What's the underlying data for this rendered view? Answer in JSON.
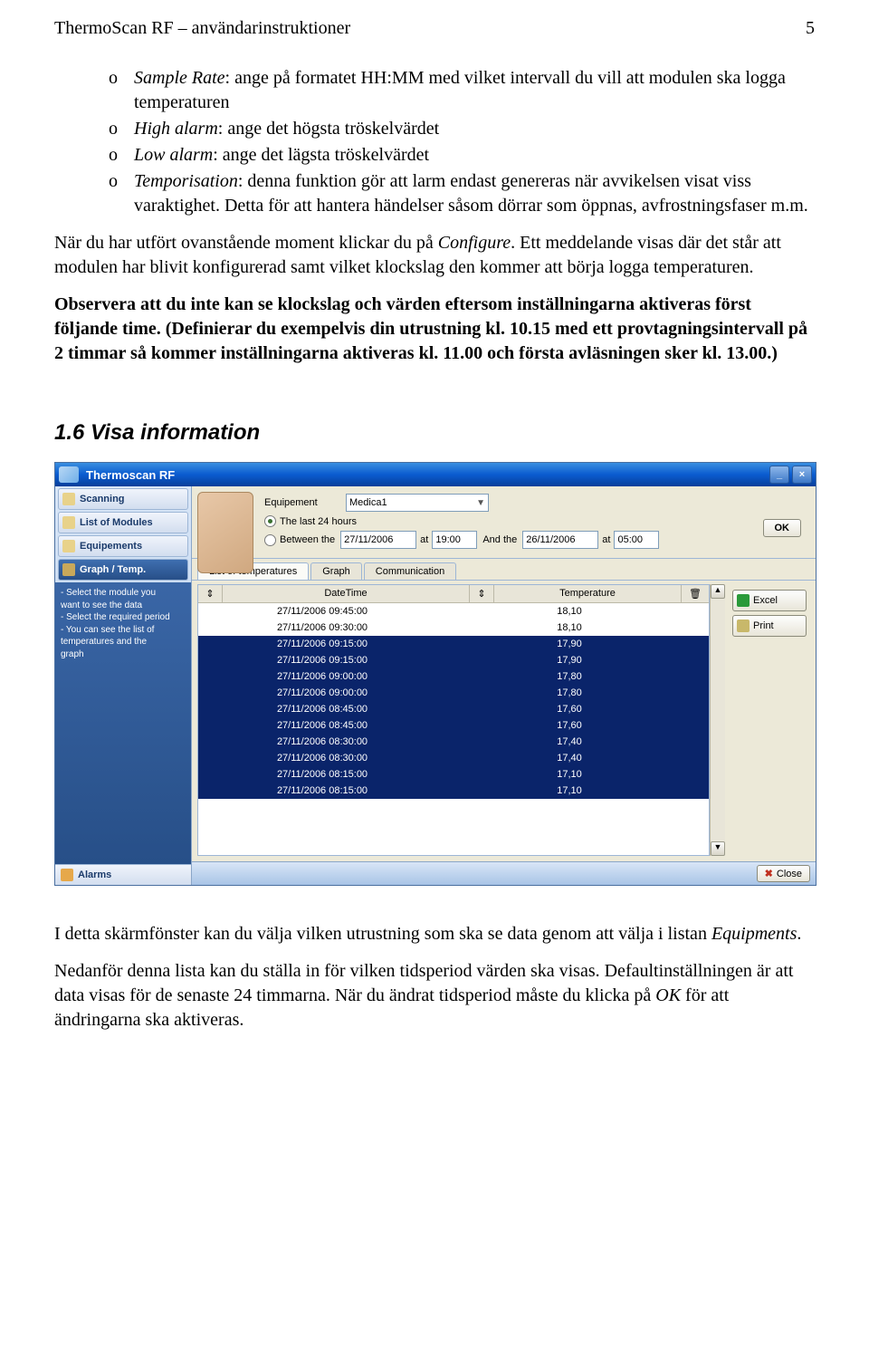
{
  "header": {
    "title": "ThermoScan RF – användarinstruktioner",
    "page": "5"
  },
  "bullets": [
    {
      "term": "Sample Rate",
      "text": ": ange på formatet HH:MM med vilket intervall du vill att modulen ska logga temperaturen"
    },
    {
      "term": "High alarm",
      "text": ": ange det högsta tröskelvärdet"
    },
    {
      "term": "Low alarm",
      "text": ": ange det lägsta tröskelvärdet"
    },
    {
      "term": "Temporisation",
      "text": ": denna funktion gör att larm endast genereras när avvikelsen visat viss varaktighet. Detta för att hantera händelser såsom dörrar som öppnas, avfrostningsfaser m.m."
    }
  ],
  "para1_a": "När du har utfört ovanstående moment klickar du på ",
  "para1_term": "Configure",
  "para1_b": ". Ett meddelande visas där det står att modulen har blivit konfigurerad samt vilket klockslag den kommer att börja logga temperaturen.",
  "para2": "Observera att du inte kan se klockslag och värden eftersom inställningarna aktiveras först följande time. (Definierar du exempelvis din utrustning kl. 10.15 med ett provtagningsintervall på 2 timmar så kommer inställningarna aktiveras kl. 11.00 och första avläsningen sker kl. 13.00.)",
  "section": "1.6  Visa information",
  "ui": {
    "title": "Thermoscan RF",
    "sidebar": {
      "items": [
        "Scanning",
        "List of Modules",
        "Equipements",
        "Graph / Temp."
      ],
      "help": [
        "- Select the module you",
        "want to see the data",
        "- Select the required period",
        "- You can see the list of",
        "temperatures and the",
        "graph"
      ],
      "alarms": "Alarms"
    },
    "form": {
      "equipement_label": "Equipement",
      "equipement_value": "Medica1",
      "opt1": "The last 24 hours",
      "opt2": "Between the",
      "at": "at",
      "andthe": "And the",
      "date1": "27/11/2006",
      "time1": "19:00",
      "date2": "26/11/2006",
      "time2": "05:00",
      "ok": "OK"
    },
    "tabs": [
      "List of temperatures",
      "Graph",
      "Communication"
    ],
    "columns": {
      "dt": "DateTime",
      "temp": "Temperature"
    },
    "rows": [
      {
        "dt": "27/11/2006 09:45:00",
        "temp": "18,10",
        "sel": false
      },
      {
        "dt": "27/11/2006 09:30:00",
        "temp": "18,10",
        "sel": false
      },
      {
        "dt": "27/11/2006 09:15:00",
        "temp": "17,90",
        "sel": true
      },
      {
        "dt": "27/11/2006 09:15:00",
        "temp": "17,90",
        "sel": true
      },
      {
        "dt": "27/11/2006 09:00:00",
        "temp": "17,80",
        "sel": true
      },
      {
        "dt": "27/11/2006 09:00:00",
        "temp": "17,80",
        "sel": true
      },
      {
        "dt": "27/11/2006 08:45:00",
        "temp": "17,60",
        "sel": true
      },
      {
        "dt": "27/11/2006 08:45:00",
        "temp": "17,60",
        "sel": true
      },
      {
        "dt": "27/11/2006 08:30:00",
        "temp": "17,40",
        "sel": true
      },
      {
        "dt": "27/11/2006 08:30:00",
        "temp": "17,40",
        "sel": true
      },
      {
        "dt": "27/11/2006 08:15:00",
        "temp": "17,10",
        "sel": true
      },
      {
        "dt": "27/11/2006 08:15:00",
        "temp": "17,10",
        "sel": true
      }
    ],
    "actions": {
      "excel": "Excel",
      "print": "Print"
    },
    "close": "Close"
  },
  "footer": {
    "p1a": "I detta skärmfönster kan du välja vilken utrustning som ska se data genom att välja i listan ",
    "p1term": "Equipments",
    "p1b": ".",
    "p2": "Nedanför denna lista kan du ställa in för vilken tidsperiod värden ska visas. Defaultinställningen är att data visas för de senaste 24 timmarna. När du ändrat tidsperiod måste du klicka på ",
    "p2term": "OK",
    "p2b": " för att ändringarna ska aktiveras."
  }
}
